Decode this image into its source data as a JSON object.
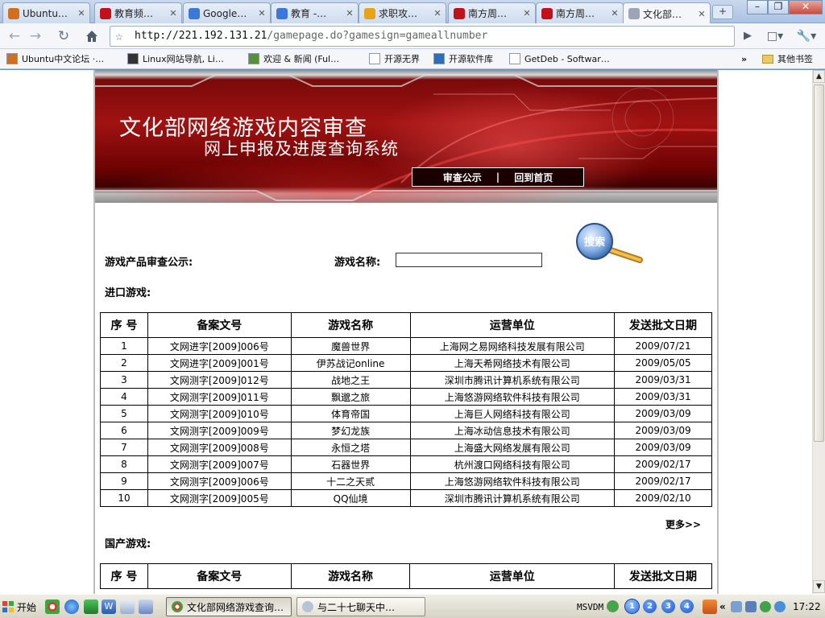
{
  "browser": {
    "tabs": [
      {
        "label": "Ubuntu…",
        "icon": "ubuntu-icon",
        "color": "#d36f1b",
        "active": false
      },
      {
        "label": "教育频…",
        "icon": "cctv-icon",
        "color": "#c0121b",
        "active": false
      },
      {
        "label": "Google…",
        "icon": "google-icon",
        "color": "#3c78d8",
        "active": false
      },
      {
        "label": "教育 -…",
        "icon": "google-icon",
        "color": "#3c78d8",
        "active": false
      },
      {
        "label": "求职攻…",
        "icon": "page-icon",
        "color": "#e8a31a",
        "active": false
      },
      {
        "label": "南方周…",
        "icon": "nanfang-icon",
        "color": "#c0121b",
        "active": false
      },
      {
        "label": "南方周…",
        "icon": "nanfang-icon",
        "color": "#c0121b",
        "active": false
      },
      {
        "label": "文化部…",
        "icon": "page-icon",
        "color": "#9aa6b8",
        "active": true
      }
    ],
    "url_host": "http://221.192.131.21",
    "url_path": "/gamepage.do?gamesign=gameallnumber",
    "window_controls": {
      "minimize": "–",
      "maximize": "❐",
      "close": "✕"
    },
    "bookmarks": [
      {
        "label": "Ubuntu中文论坛 ·…",
        "icon": "ubuntu-icon"
      },
      {
        "label": "Linux网站导航, Li…",
        "icon": "tux-icon"
      },
      {
        "label": "欢迎 & 新闻 (Ful…",
        "icon": "news-icon"
      },
      {
        "label": "开源无界",
        "icon": "page-icon"
      },
      {
        "label": "开源软件库",
        "icon": "sf-icon"
      },
      {
        "label": "GetDeb - Softwar…",
        "icon": "page-icon"
      }
    ],
    "bookmarks_overflow": "»",
    "other_bookmarks": "其他书签"
  },
  "site": {
    "title_line1": "文化部网络游戏内容审查",
    "title_line2": "网上申报及进度查询系统",
    "nav": {
      "publicity": "审查公示",
      "separator": "|",
      "home": "回到首页"
    },
    "announcement_label": "游戏产品审查公示:",
    "game_name_label": "游戏名称:",
    "search_input_value": "",
    "search_button": "搜索",
    "imported_heading": "进口游戏:",
    "domestic_heading": "国产游戏:",
    "more_link": "更多>>",
    "table_headers": [
      "序 号",
      "备案文号",
      "游戏名称",
      "运营单位",
      "发送批文日期"
    ],
    "imported_rows": [
      [
        "1",
        "文网进字[2009]006号",
        "魔兽世界",
        "上海网之易网络科技发展有限公司",
        "2009/07/21"
      ],
      [
        "2",
        "文网进字[2009]001号",
        "伊苏战记online",
        "上海天希网络技术有限公司",
        "2009/05/05"
      ],
      [
        "3",
        "文网测字[2009]012号",
        "战地之王",
        "深圳市腾讯计算机系统有限公司",
        "2009/03/31"
      ],
      [
        "4",
        "文网测字[2009]011号",
        "飘邈之旅",
        "上海悠游网络软件科技有限公司",
        "2009/03/31"
      ],
      [
        "5",
        "文网测字[2009]010号",
        "体育帝国",
        "上海巨人网络科技有限公司",
        "2009/03/09"
      ],
      [
        "6",
        "文网测字[2009]009号",
        "梦幻龙族",
        "上海冰动信息技术有限公司",
        "2009/03/09"
      ],
      [
        "7",
        "文网测字[2009]008号",
        "永恒之塔",
        "上海盛大网络发展有限公司",
        "2009/03/09"
      ],
      [
        "8",
        "文网测字[2009]007号",
        "石器世界",
        "杭州渡口网络科技有限公司",
        "2009/02/17"
      ],
      [
        "9",
        "文网测字[2009]006号",
        "十二之天贰",
        "上海悠游网络软件科技有限公司",
        "2009/02/17"
      ],
      [
        "10",
        "文网测字[2009]005号",
        "QQ仙境",
        "深圳市腾讯计算机系统有限公司",
        "2009/02/10"
      ]
    ]
  },
  "taskbar": {
    "start_label": "开始",
    "tasks": [
      {
        "label": "文化部网络游戏查询…",
        "icon": "chrome-icon",
        "active": true
      },
      {
        "label": "与二十七聊天中…",
        "icon": "chat-icon",
        "active": false
      }
    ],
    "ime_label": "MSVDM",
    "workspaces": [
      "1",
      "2",
      "3",
      "4"
    ],
    "overflow": "«",
    "clock": "17:22"
  },
  "colors": {
    "banner_red": "#a11212",
    "accent_blue": "#3c78d8"
  }
}
